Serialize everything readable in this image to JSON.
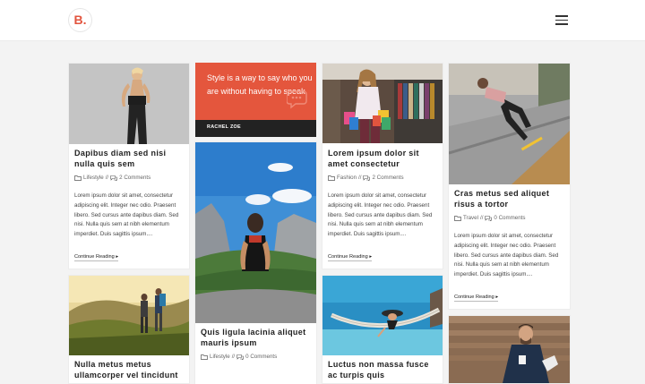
{
  "header": {
    "logo": "B.",
    "menu_icon": "hamburger-icon"
  },
  "quote": {
    "text": "Style is a way to say who you are without having to speak.",
    "author": "RACHEL ZOE",
    "icon": "speech-bubble-icon"
  },
  "posts": [
    {
      "title": "Dapibus diam sed nisi nulla quis sem",
      "category": "Lifestyle",
      "separator": "//",
      "comments": "2 Comments",
      "excerpt": "Lorem ipsum dolor sit amet, consectetur adipiscing elit. Integer nec odio. Praesent libero. Sed cursus ante dapibus diam. Sed nisi. Nulla quis sem at nibh elementum imperdiet. Duis sagittis ipsum....",
      "more": "Continue Reading",
      "more_icon": "caret-right-icon"
    },
    {
      "title": "Lorem ipsum dolor sit amet consectetur",
      "category": "Fashion",
      "separator": "//",
      "comments": "2 Comments",
      "excerpt": "Lorem ipsum dolor sit amet, consectetur adipiscing elit. Integer nec odio. Praesent libero. Sed cursus ante dapibus diam. Sed nisi. Nulla quis sem at nibh elementum imperdiet. Duis sagittis ipsum....",
      "more": "Continue Reading",
      "more_icon": "caret-right-icon"
    },
    {
      "title": "Cras metus sed aliquet risus a tortor",
      "category": "Travel",
      "separator": "//",
      "comments": "0 Comments",
      "excerpt": "Lorem ipsum dolor sit amet, consectetur adipiscing elit. Integer nec odio. Praesent libero. Sed cursus ante dapibus diam. Sed nisi. Nulla quis sem at nibh elementum imperdiet. Duis sagittis ipsum....",
      "more": "Continue Reading",
      "more_icon": "caret-right-icon"
    },
    {
      "title": "Quis ligula lacinia aliquet mauris ipsum",
      "category": "Lifestyle",
      "separator": "//",
      "comments": "0 Comments"
    },
    {
      "title": "Nulla metus metus ullamcorper vel tincidunt"
    },
    {
      "title": "Luctus non massa fusce ac turpis quis"
    }
  ]
}
